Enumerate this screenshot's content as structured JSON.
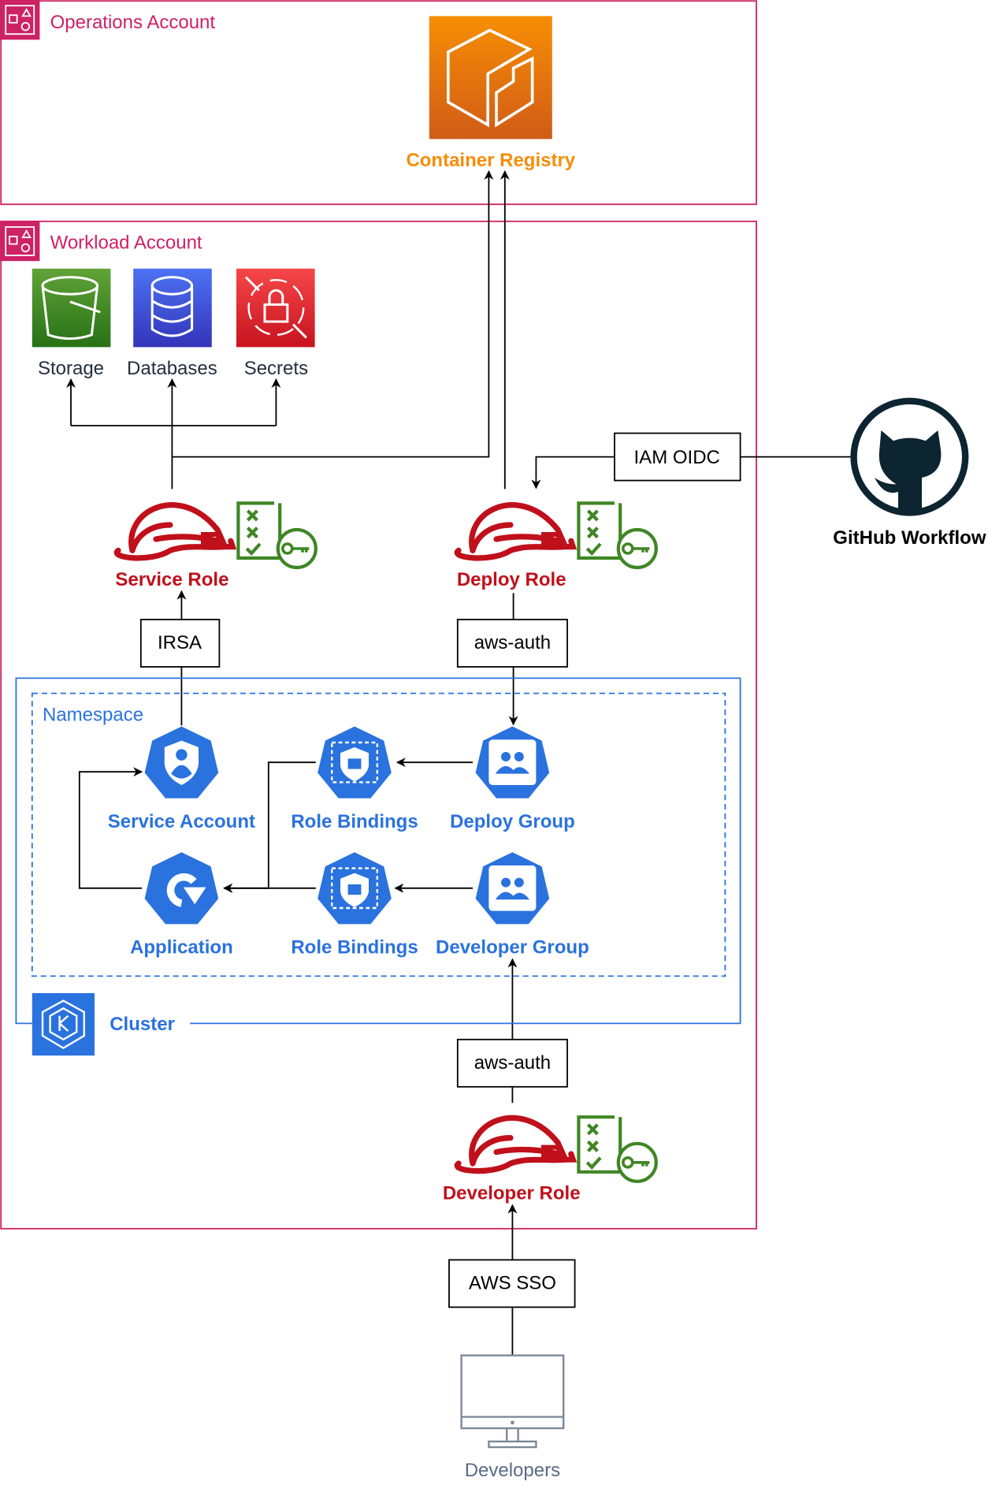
{
  "accounts": {
    "operations": "Operations Account",
    "workload": "Workload Account"
  },
  "services": {
    "registry": "Container Registry",
    "storage": "Storage",
    "databases": "Databases",
    "secrets": "Secrets"
  },
  "roles": {
    "service": "Service Role",
    "deploy": "Deploy Role",
    "developer": "Developer Role"
  },
  "connectors": {
    "oidc": "IAM OIDC",
    "irsa": "IRSA",
    "aws_auth_deploy": "aws-auth",
    "aws_auth_dev": "aws-auth",
    "sso": "AWS SSO"
  },
  "external": {
    "github": "GitHub Workflow",
    "developers": "Developers"
  },
  "k8s": {
    "namespace": "Namespace",
    "cluster": "Cluster",
    "service_account": "Service Account",
    "role_bindings_1": "Role Bindings",
    "deploy_group": "Deploy Group",
    "application": "Application",
    "role_bindings_2": "Role Bindings",
    "developer_group": "Developer Group"
  },
  "colors": {
    "account": "#CD2264",
    "registry": "#F68D08",
    "role": "#C0101B",
    "k8s": "#2A72DE",
    "policy": "#3F8624",
    "github": "#0D2431"
  }
}
